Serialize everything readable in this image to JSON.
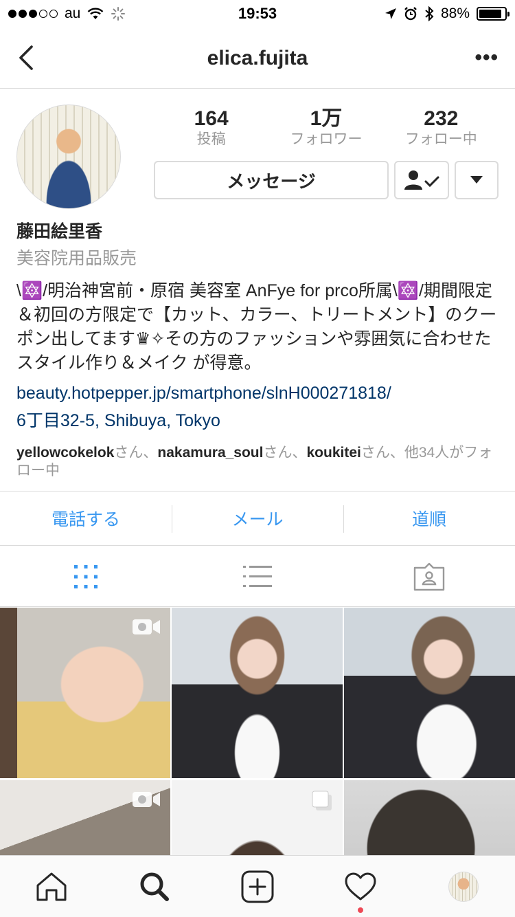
{
  "status_bar": {
    "carrier": "au",
    "time": "19:53",
    "battery": "88%",
    "battery_level": 0.88,
    "signal_bars_filled": 3,
    "signal_bars_total": 5
  },
  "nav": {
    "title": "elica.fujita",
    "more": "•••"
  },
  "profile": {
    "stats": [
      {
        "value": "164",
        "label": "投稿"
      },
      {
        "value": "1万",
        "label": "フォロワー"
      },
      {
        "value": "232",
        "label": "フォロー中"
      }
    ],
    "message_button": "メッセージ",
    "full_name": "藤田絵里香",
    "category": "美容院用品販売",
    "bio": "\\🔯/明治神宮前・原宿 美容室 AnFye for prco所属\\🔯/期間限定＆初回の方限定で【カット、カラー、トリートメント】のクーポン出してます♛✧その方のファッションや雰囲気に合わせたスタイル作り＆メイク が得意。",
    "link": "beauty.hotpepper.jp/smartphone/slnH000271818/",
    "address": "6丁目32-5, Shibuya, Tokyo",
    "followed_by": {
      "user1": "yellowcokelok",
      "sep1": "さん、",
      "user2": "nakamura_soul",
      "sep2": "さん、",
      "user3": "koukitei",
      "rest": "さん、他34人がフォロー中"
    }
  },
  "contact": {
    "call": "電話する",
    "email": "メール",
    "directions": "道順"
  },
  "view_tabs": [
    "grid-icon",
    "list-icon",
    "tagged-icon"
  ],
  "colors": {
    "accent": "#3897f0",
    "link": "#003569",
    "muted": "#999999",
    "border": "#dbdbdb",
    "notification": "#ed4956"
  }
}
